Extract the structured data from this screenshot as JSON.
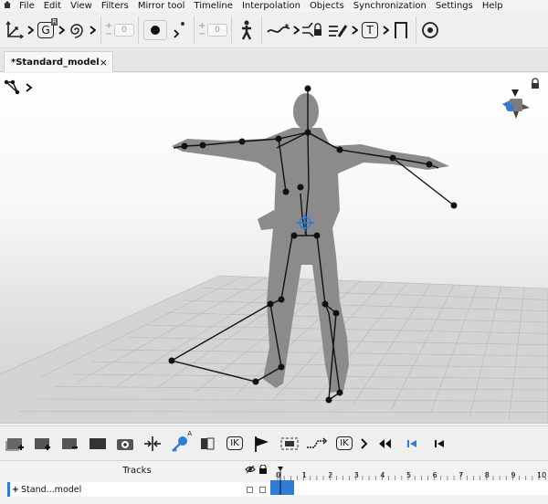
{
  "menu": {
    "home_icon": "home-icon",
    "items": [
      "File",
      "Edit",
      "View",
      "Filters",
      "Mirror tool",
      "Timeline",
      "Interpolation",
      "Objects",
      "Synchronization",
      "Settings",
      "Help"
    ]
  },
  "toolbar": {
    "rot_value": "0",
    "pos_value": "0",
    "g_label": "G",
    "g_badge": "R",
    "t_label": "T",
    "plus": "+",
    "minus": "−"
  },
  "tab": {
    "title": "*Standard_model",
    "close": "×"
  },
  "bottom_toolbar": {
    "ik1": "IK",
    "ik2": "IK",
    "key_badge": "A"
  },
  "tracks": {
    "title": "Tracks",
    "row_label": "Stand...model",
    "row_expand": "+",
    "ticks": [
      "0",
      "1",
      "2",
      "3",
      "4",
      "5",
      "6",
      "7",
      "8",
      "9",
      "10"
    ],
    "playhead_frame": 0
  },
  "colors": {
    "accent": "#2f7bd6",
    "bone": "#111111",
    "model": "#8a8a8a"
  }
}
